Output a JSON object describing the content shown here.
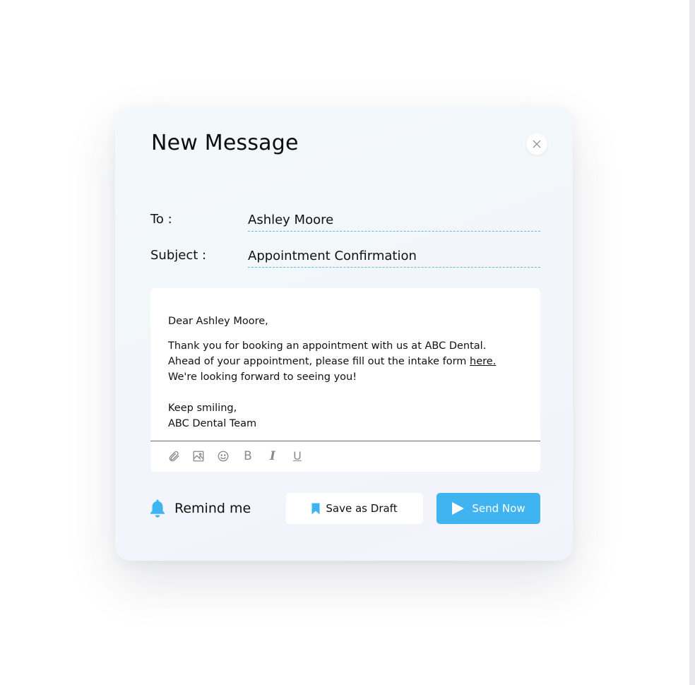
{
  "dialog": {
    "title": "New Message",
    "close_icon": "close-icon"
  },
  "fields": {
    "to_label": "To :",
    "to_value": "Ashley Moore",
    "subject_label": "Subject :",
    "subject_value": "Appointment Confirmation"
  },
  "message": {
    "greeting": "Dear Ashley Moore,",
    "line1": "Thank you for booking an appointment with us at ABC Dental.",
    "line2_prefix": "Ahead of your appointment, please fill out the intake form",
    "link_text": "here.",
    "line3": "We're looking forward to seeing you!",
    "signoff": "Keep smiling,",
    "signature": "ABC Dental Team"
  },
  "toolbar": {
    "icons": [
      "paperclip-icon",
      "image-icon",
      "emoji-icon",
      "bold-icon",
      "italic-icon",
      "underline-icon"
    ],
    "bold_label": "B",
    "italic_label": "I",
    "underline_label": "U"
  },
  "actions": {
    "remind_label": "Remind me",
    "remind_icon": "bell-icon",
    "draft_label": "Save as Draft",
    "draft_icon": "bookmark-icon",
    "send_label": "Send Now",
    "send_icon": "play-icon"
  },
  "colors": {
    "accent": "#3fb4f0",
    "dashed_underline": "#5fb8e8",
    "toolbar_icon": "#8a8a8a"
  }
}
